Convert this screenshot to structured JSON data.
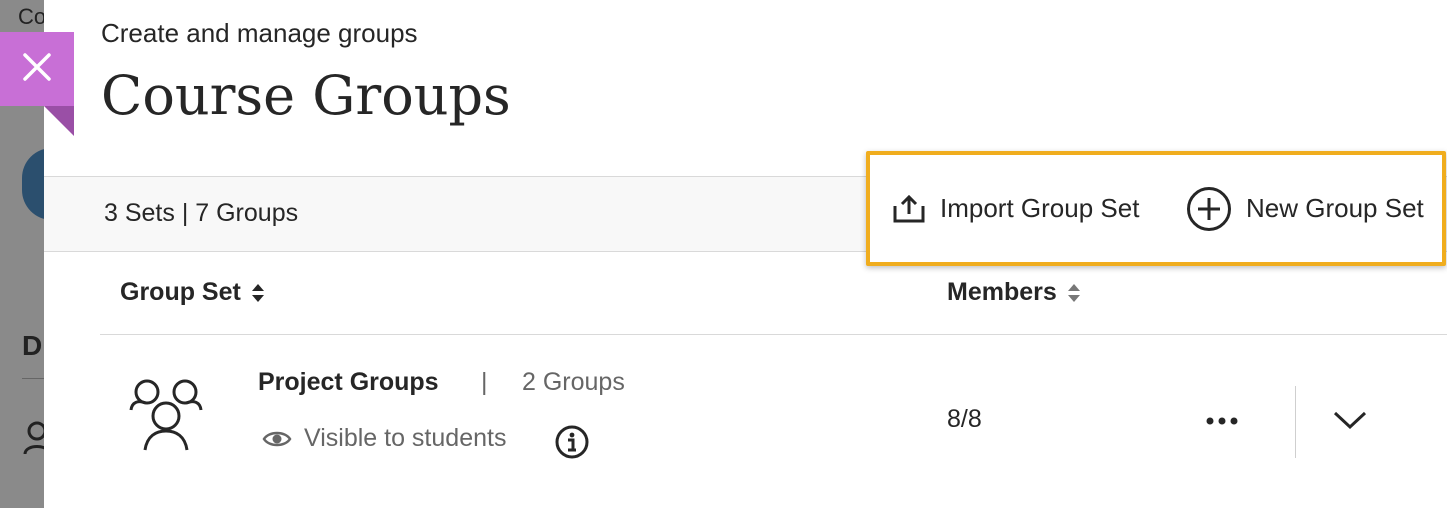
{
  "background": {
    "text": "Co",
    "letter": "D"
  },
  "close": {
    "icon": "close-icon",
    "color": "#c86fd6"
  },
  "header": {
    "subtitle": "Create and manage groups",
    "title": "Course Groups"
  },
  "toolbar": {
    "counts": "3 Sets | 7 Groups",
    "import_label": "Import Group Set",
    "import_icon": "upload-icon",
    "new_label": "New Group Set",
    "new_icon": "plus-circle-icon",
    "highlight_color": "#f0ad1e"
  },
  "table": {
    "columns": [
      {
        "label": "Group Set",
        "sort_icon": "sort-icon"
      },
      {
        "label": "Members",
        "sort_icon": "sort-icon"
      }
    ],
    "rows": [
      {
        "name": "Project Groups",
        "separator": "|",
        "group_count": "2 Groups",
        "visibility": "Visible to students",
        "members": "8/8",
        "icon": "people-group-icon"
      }
    ]
  }
}
